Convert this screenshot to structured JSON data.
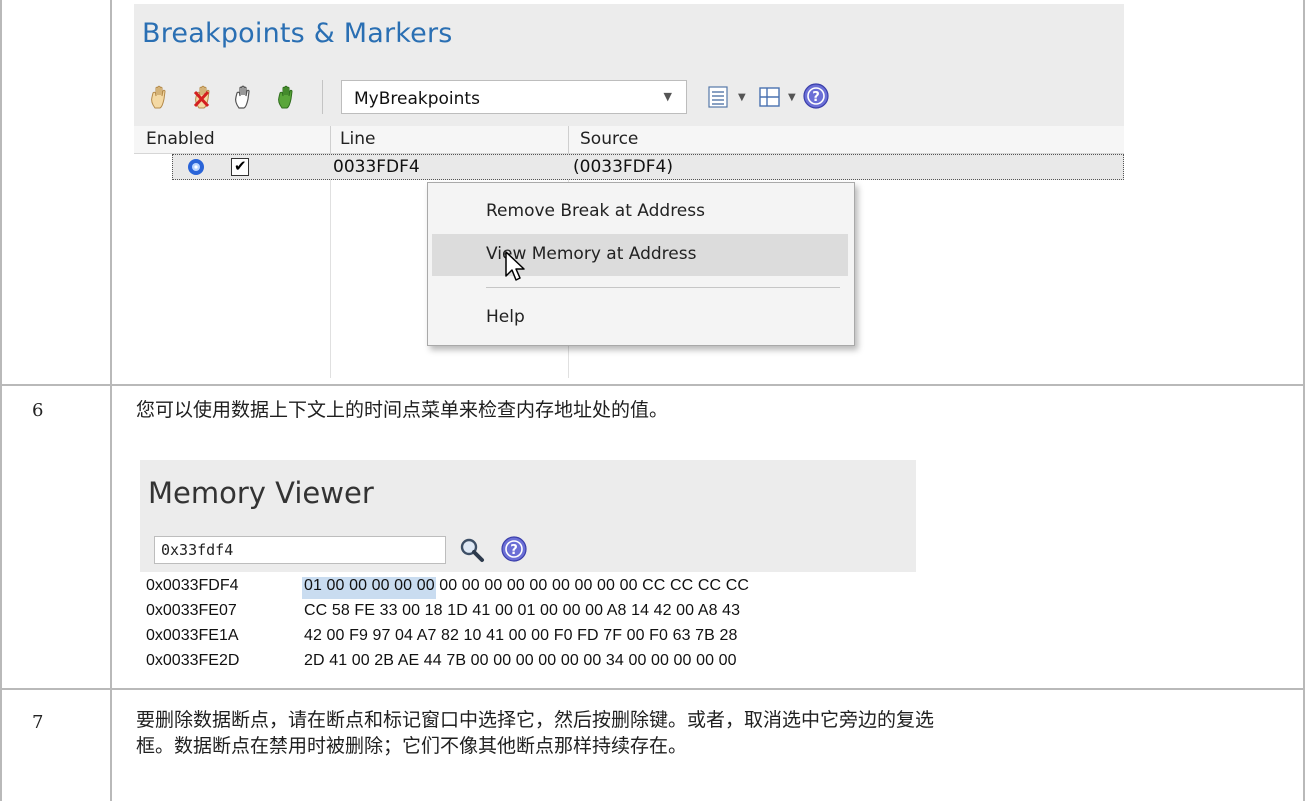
{
  "breakpoints_window": {
    "title": "Breakpoints & Markers",
    "toolbar": {
      "icons": [
        "hand-icon",
        "hand-delete-icon",
        "hand-disabled-icon",
        "hand-green-icon"
      ],
      "breakpoint_set": "MyBreakpoints",
      "list-view-icon": "list-view-icon",
      "layout-icon": "layout-icon",
      "help-icon": "help-icon"
    },
    "columns": [
      "Enabled",
      "Line",
      "Source"
    ],
    "rows": [
      {
        "enabled": true,
        "line": "0033FDF4",
        "source": "(0033FDF4)"
      }
    ],
    "context_menu": {
      "items": [
        "Remove Break at Address",
        "View Memory at Address",
        "Help"
      ],
      "highlighted": "View Memory at Address"
    }
  },
  "steps": [
    {
      "number": "6",
      "text": "您可以使用数据上下文上的时间点菜单来检查内存地址处的值。"
    },
    {
      "number": "7",
      "text_line1": "要删除数据断点，请在断点和标记窗口中选择它，然后按删除键。或者，取消选中它旁边的复选",
      "text_line2": "框。数据断点在禁用时被删除；它们不像其他断点那样持续存在。"
    }
  ],
  "memory_viewer": {
    "title": "Memory Viewer",
    "address_value": "0x33fdf4",
    "rows": [
      {
        "address": "0x0033FDF4",
        "bytes": "01 00 00 00 00 00 00 00 00 00 00 00 00 00 00 CC CC CC CC"
      },
      {
        "address": "0x0033FE07",
        "bytes": "CC 58 FE 33 00 18 1D 41 00 01 00 00 00 A8 14 42 00 A8 43"
      },
      {
        "address": "0x0033FE1A",
        "bytes": "42 00 F9 97 04 A7 82 10 41 00 00 F0 FD 7F 00 F0 63 7B 28"
      },
      {
        "address": "0x0033FE2D",
        "bytes": "2D 41 00 2B AE 44 7B 00 00 00 00 00 00 34 00 00 00 00 00"
      }
    ]
  }
}
